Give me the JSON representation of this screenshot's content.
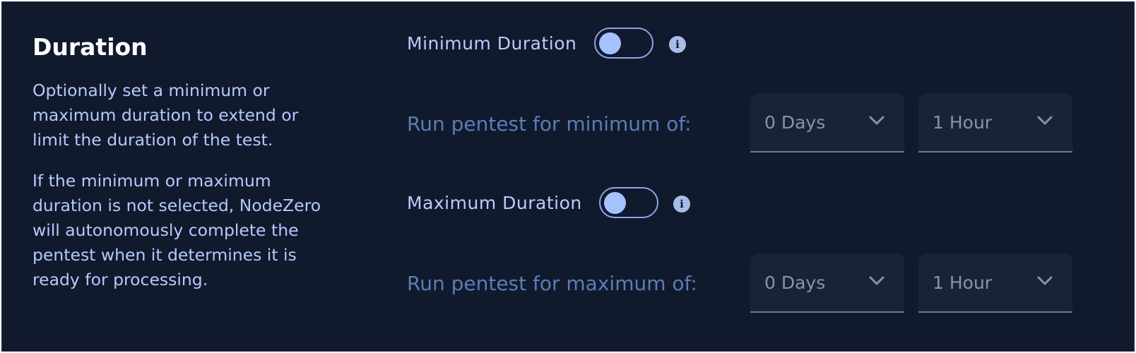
{
  "section": {
    "title": "Duration",
    "description_1": "Optionally set a minimum or maximum duration to extend or limit the duration of the test.",
    "description_2": "If the minimum or maximum duration is not selected, NodeZero will autonomously complete the pentest when it determines it is ready for processing."
  },
  "minimum": {
    "toggle_label": "Minimum Duration",
    "toggle_on": false,
    "info_icon": "info-icon",
    "run_label": "Run pentest for minimum of:",
    "days_value": "0 Days",
    "hours_value": "1 Hour"
  },
  "maximum": {
    "toggle_label": "Maximum Duration",
    "toggle_on": false,
    "info_icon": "info-icon",
    "run_label": "Run pentest for maximum of:",
    "days_value": "0 Days",
    "hours_value": "1 Hour"
  },
  "icons": {
    "info_glyph": "i",
    "dropdown": "chevron-down-icon"
  },
  "colors": {
    "background": "#111a2c",
    "title": "#ffffff",
    "description": "#b4c9ff",
    "toggle_label": "#b9ccff",
    "run_label": "#5c7bb8",
    "toggle_knob": "#a6c1ff",
    "select_background": "#182338"
  }
}
